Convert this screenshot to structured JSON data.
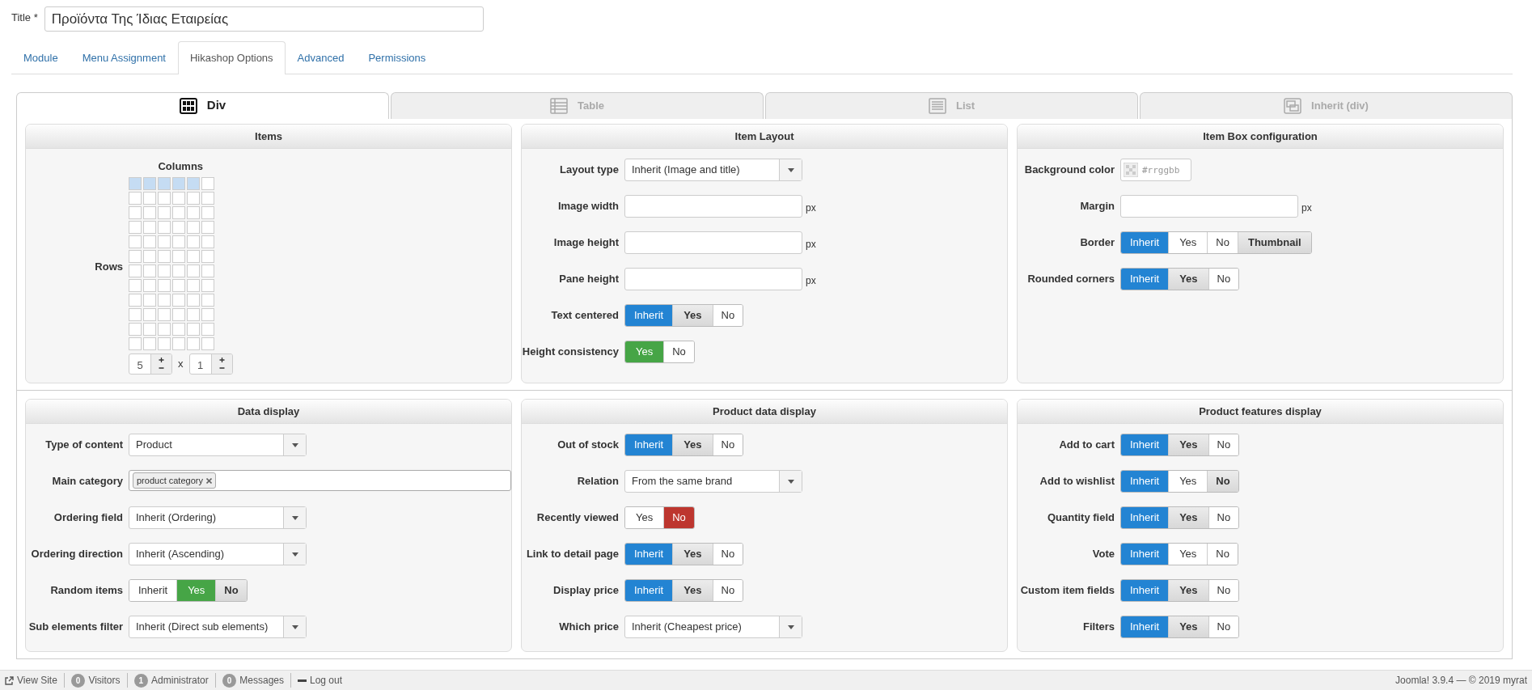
{
  "title_field": {
    "label": "Title *",
    "value": "Προϊόντα Της Ίδιας Εταιρείας"
  },
  "tabs": [
    {
      "label": "Module",
      "selected": false
    },
    {
      "label": "Menu Assignment",
      "selected": false
    },
    {
      "label": "Hikashop Options",
      "selected": true
    },
    {
      "label": "Advanced",
      "selected": false
    },
    {
      "label": "Permissions",
      "selected": false
    }
  ],
  "layout_tabs": [
    {
      "label": "Div",
      "selected": true,
      "kind": "div"
    },
    {
      "label": "Table",
      "selected": false,
      "kind": "table"
    },
    {
      "label": "List",
      "selected": false,
      "kind": "list"
    },
    {
      "label": "Inherit (div)",
      "selected": false,
      "kind": "inherit"
    }
  ],
  "sections": [
    {
      "panels": [
        {
          "title": "Items",
          "kind": "items",
          "columns_label": "Columns",
          "rows_label": "Rows",
          "columns_value": "5",
          "rows_value": "1",
          "times": "x",
          "selection_grid": [
            [
              true,
              true,
              true,
              true,
              true,
              false
            ],
            [
              false,
              false,
              false,
              false,
              false,
              false
            ],
            [
              false,
              false,
              false,
              false,
              false,
              false
            ],
            [
              false,
              false,
              false,
              false,
              false,
              false
            ],
            [
              false,
              false,
              false,
              false,
              false,
              false
            ],
            [
              false,
              false,
              false,
              false,
              false,
              false
            ],
            [
              false,
              false,
              false,
              false,
              false,
              false
            ],
            [
              false,
              false,
              false,
              false,
              false,
              false
            ],
            [
              false,
              false,
              false,
              false,
              false,
              false
            ],
            [
              false,
              false,
              false,
              false,
              false,
              false
            ],
            [
              false,
              false,
              false,
              false,
              false,
              false
            ],
            [
              false,
              false,
              false,
              false,
              false,
              false
            ]
          ]
        },
        {
          "title": "Item Layout",
          "kind": "form",
          "fields": [
            {
              "kind": "select",
              "label": "Layout type",
              "value": "Inherit (Image and title)"
            },
            {
              "kind": "text",
              "label": "Image width",
              "unit": "px"
            },
            {
              "kind": "text",
              "label": "Image height",
              "unit": "px"
            },
            {
              "kind": "text",
              "label": "Pane height",
              "unit": "px"
            },
            {
              "kind": "toggle",
              "label": "Text centered",
              "options": [
                {
                  "label": "Inherit",
                  "kind": "inherit",
                  "selected": true,
                  "default": false
                },
                {
                  "label": "Yes",
                  "kind": "yes",
                  "selected": false,
                  "default": true
                },
                {
                  "label": "No",
                  "kind": "no",
                  "selected": false,
                  "default": false
                }
              ]
            },
            {
              "kind": "toggle",
              "label": "Height consistency",
              "options": [
                {
                  "label": "Yes",
                  "kind": "yes",
                  "selected": true,
                  "default": false
                },
                {
                  "label": "No",
                  "kind": "no",
                  "selected": false,
                  "default": false
                }
              ]
            }
          ]
        },
        {
          "title": "Item Box configuration",
          "kind": "form",
          "fields": [
            {
              "kind": "color",
              "label": "Background color",
              "placeholder": "#rrggbb"
            },
            {
              "kind": "text",
              "label": "Margin",
              "unit": "px"
            },
            {
              "kind": "toggle",
              "label": "Border",
              "options": [
                {
                  "label": "Inherit",
                  "kind": "inherit",
                  "selected": true,
                  "default": false
                },
                {
                  "label": "Yes",
                  "kind": "yes",
                  "selected": false,
                  "default": false
                },
                {
                  "label": "No",
                  "kind": "no",
                  "selected": false,
                  "default": false
                },
                {
                  "label": "Thumbnail",
                  "kind": "thumbnail",
                  "selected": false,
                  "default": true
                }
              ]
            },
            {
              "kind": "toggle",
              "label": "Rounded corners",
              "options": [
                {
                  "label": "Inherit",
                  "kind": "inherit",
                  "selected": true,
                  "default": false
                },
                {
                  "label": "Yes",
                  "kind": "yes",
                  "selected": false,
                  "default": true
                },
                {
                  "label": "No",
                  "kind": "no",
                  "selected": false,
                  "default": false
                }
              ]
            }
          ]
        }
      ]
    },
    {
      "panels": [
        {
          "title": "Data display",
          "kind": "form",
          "fields": [
            {
              "kind": "select",
              "label": "Type of content",
              "value": "Product"
            },
            {
              "kind": "tags",
              "label": "Main category",
              "tags": [
                "product category"
              ]
            },
            {
              "kind": "select",
              "label": "Ordering field",
              "value": "Inherit (Ordering)"
            },
            {
              "kind": "select",
              "label": "Ordering direction",
              "value": "Inherit (Ascending)"
            },
            {
              "kind": "toggle",
              "label": "Random items",
              "options": [
                {
                  "label": "Inherit",
                  "kind": "inherit",
                  "selected": false,
                  "default": false
                },
                {
                  "label": "Yes",
                  "kind": "yes",
                  "selected": true,
                  "default": false
                },
                {
                  "label": "No",
                  "kind": "no",
                  "selected": false,
                  "default": true
                }
              ]
            },
            {
              "kind": "select",
              "label": "Sub elements filter",
              "value": "Inherit (Direct sub elements)"
            }
          ]
        },
        {
          "title": "Product data display",
          "kind": "form",
          "fields": [
            {
              "kind": "toggle",
              "label": "Out of stock",
              "options": [
                {
                  "label": "Inherit",
                  "kind": "inherit",
                  "selected": true,
                  "default": false
                },
                {
                  "label": "Yes",
                  "kind": "yes",
                  "selected": false,
                  "default": true
                },
                {
                  "label": "No",
                  "kind": "no",
                  "selected": false,
                  "default": false
                }
              ]
            },
            {
              "kind": "select",
              "label": "Relation",
              "value": "From the same brand"
            },
            {
              "kind": "toggle",
              "label": "Recently viewed",
              "options": [
                {
                  "label": "Yes",
                  "kind": "yes",
                  "selected": false,
                  "default": false
                },
                {
                  "label": "No",
                  "kind": "no",
                  "selected": true,
                  "default": false
                }
              ]
            },
            {
              "kind": "toggle",
              "label": "Link to detail page",
              "options": [
                {
                  "label": "Inherit",
                  "kind": "inherit",
                  "selected": true,
                  "default": false
                },
                {
                  "label": "Yes",
                  "kind": "yes",
                  "selected": false,
                  "default": true
                },
                {
                  "label": "No",
                  "kind": "no",
                  "selected": false,
                  "default": false
                }
              ]
            },
            {
              "kind": "toggle",
              "label": "Display price",
              "options": [
                {
                  "label": "Inherit",
                  "kind": "inherit",
                  "selected": true,
                  "default": false
                },
                {
                  "label": "Yes",
                  "kind": "yes",
                  "selected": false,
                  "default": true
                },
                {
                  "label": "No",
                  "kind": "no",
                  "selected": false,
                  "default": false
                }
              ]
            },
            {
              "kind": "select",
              "label": "Which price",
              "value": "Inherit (Cheapest price)"
            }
          ]
        },
        {
          "title": "Product features display",
          "kind": "form",
          "fields": [
            {
              "kind": "toggle",
              "label": "Add to cart",
              "options": [
                {
                  "label": "Inherit",
                  "kind": "inherit",
                  "selected": true,
                  "default": false
                },
                {
                  "label": "Yes",
                  "kind": "yes",
                  "selected": false,
                  "default": true
                },
                {
                  "label": "No",
                  "kind": "no",
                  "selected": false,
                  "default": false
                }
              ]
            },
            {
              "kind": "toggle",
              "label": "Add to wishlist",
              "options": [
                {
                  "label": "Inherit",
                  "kind": "inherit",
                  "selected": true,
                  "default": false
                },
                {
                  "label": "Yes",
                  "kind": "yes",
                  "selected": false,
                  "default": false
                },
                {
                  "label": "No",
                  "kind": "no",
                  "selected": false,
                  "default": true
                }
              ]
            },
            {
              "kind": "toggle",
              "label": "Quantity field",
              "options": [
                {
                  "label": "Inherit",
                  "kind": "inherit",
                  "selected": true,
                  "default": false
                },
                {
                  "label": "Yes",
                  "kind": "yes",
                  "selected": false,
                  "default": true
                },
                {
                  "label": "No",
                  "kind": "no",
                  "selected": false,
                  "default": false
                }
              ]
            },
            {
              "kind": "toggle",
              "label": "Vote",
              "options": [
                {
                  "label": "Inherit",
                  "kind": "inherit",
                  "selected": true,
                  "default": false
                },
                {
                  "label": "Yes",
                  "kind": "yes",
                  "selected": false,
                  "default": false
                },
                {
                  "label": "No",
                  "kind": "no",
                  "selected": false,
                  "default": false
                }
              ]
            },
            {
              "kind": "toggle",
              "label": "Custom item fields",
              "options": [
                {
                  "label": "Inherit",
                  "kind": "inherit",
                  "selected": true,
                  "default": false
                },
                {
                  "label": "Yes",
                  "kind": "yes",
                  "selected": false,
                  "default": true
                },
                {
                  "label": "No",
                  "kind": "no",
                  "selected": false,
                  "default": false
                }
              ]
            },
            {
              "kind": "toggle",
              "label": "Filters",
              "options": [
                {
                  "label": "Inherit",
                  "kind": "inherit",
                  "selected": true,
                  "default": false
                },
                {
                  "label": "Yes",
                  "kind": "yes",
                  "selected": false,
                  "default": true
                },
                {
                  "label": "No",
                  "kind": "no",
                  "selected": false,
                  "default": false
                }
              ]
            }
          ]
        }
      ]
    }
  ],
  "status_bar": {
    "items": [
      {
        "kind": "link",
        "label": "View Site"
      },
      {
        "kind": "count",
        "count": "0",
        "label": "Visitors"
      },
      {
        "kind": "count",
        "count": "1",
        "label": "Administrator"
      },
      {
        "kind": "count",
        "count": "0",
        "label": "Messages"
      },
      {
        "kind": "logout",
        "label": "Log out"
      }
    ],
    "version": "Joomla! 3.9.4  —  © 2019 myrat"
  }
}
